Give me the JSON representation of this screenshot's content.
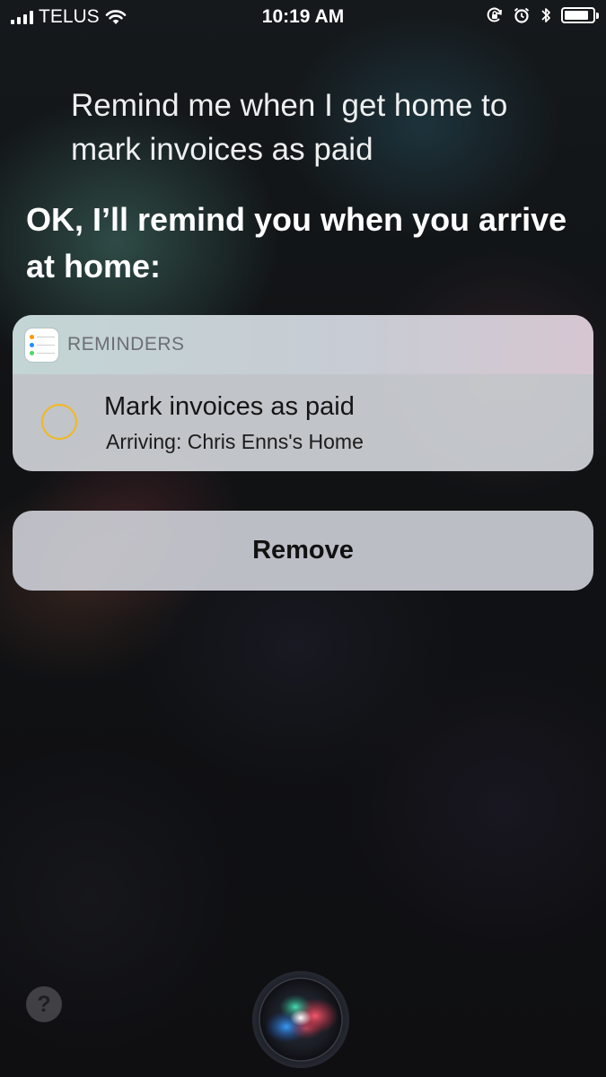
{
  "status_bar": {
    "carrier": "TELUS",
    "time": "10:19 AM",
    "battery_level": 0.85,
    "icons": [
      "signal-icon",
      "wifi-icon",
      "orientation-lock-icon",
      "alarm-icon",
      "bluetooth-icon",
      "battery-icon"
    ]
  },
  "siri": {
    "user_query": "Remind me when I get home to mark invoices as paid",
    "response": "OK, I’ll remind you when you arrive at home:"
  },
  "reminder_card": {
    "app_name": "REMINDERS",
    "app_icon": "reminders-app-icon",
    "title": "Mark invoices as paid",
    "subtitle": "Arriving: Chris Enns's Home",
    "circle_color": "#f2b81d"
  },
  "actions": {
    "remove_label": "Remove"
  },
  "bottom": {
    "help_label": "?",
    "orb_icon": "siri-orb-icon"
  }
}
